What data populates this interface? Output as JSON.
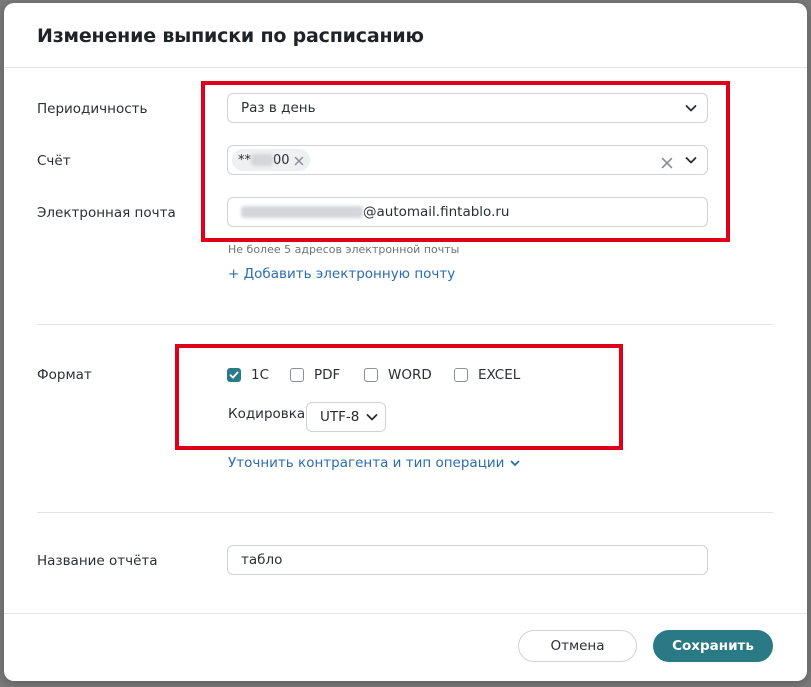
{
  "dialog": {
    "title": "Изменение выписки по расписанию"
  },
  "periodicity": {
    "label": "Периодичность",
    "value": "Раз в день"
  },
  "account": {
    "label": "Счёт",
    "chip_prefix": "**",
    "chip_suffix": "00"
  },
  "email": {
    "label": "Электронная почта",
    "value_domain": "@automail.fintablo.ru",
    "hint": "Не более 5 адресов электронной почты",
    "add_link": "+ Добавить электронную почту"
  },
  "format": {
    "label": "Формат",
    "options": [
      {
        "label": "1C",
        "checked": true
      },
      {
        "label": "PDF",
        "checked": false
      },
      {
        "label": "WORD",
        "checked": false
      },
      {
        "label": "EXCEL",
        "checked": false
      }
    ],
    "encoding_label": "Кодировка",
    "encoding_value": "UTF-8",
    "refine_link": "Уточнить контрагента и тип операции"
  },
  "report_name": {
    "label": "Название отчёта",
    "value": "табло"
  },
  "buttons": {
    "cancel": "Отмена",
    "save": "Сохранить"
  },
  "colors": {
    "accent": "#2a7a86",
    "link": "#2a6db0",
    "highlight": "#e0001a"
  }
}
